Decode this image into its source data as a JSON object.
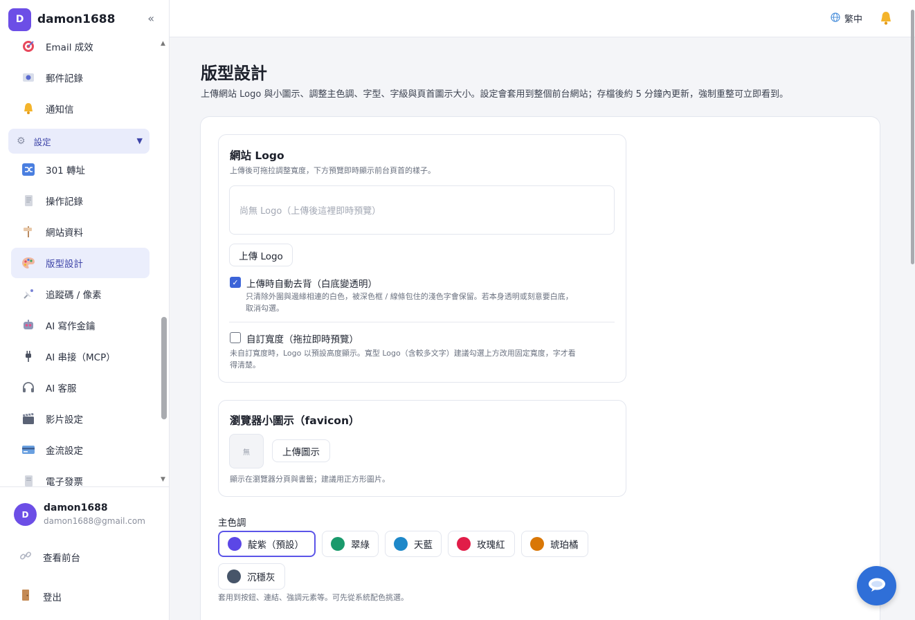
{
  "brand": {
    "initial": "D",
    "name": "damon1688",
    "collapse_glyph": "«"
  },
  "sidebar": {
    "items": [
      {
        "label": "Email 成效",
        "icon": "target-icon"
      },
      {
        "label": "郵件記錄",
        "icon": "mail-log-icon"
      },
      {
        "label": "通知信",
        "icon": "bell-icon"
      },
      {
        "label": "設定",
        "icon": "gear-icon",
        "group": true,
        "expanded": true
      },
      {
        "label": "301 轉址",
        "icon": "shuffle-icon"
      },
      {
        "label": "操作記錄",
        "icon": "scroll-icon"
      },
      {
        "label": "網站資料",
        "icon": "signpost-icon"
      },
      {
        "label": "版型設計",
        "icon": "palette-icon",
        "active": true
      },
      {
        "label": "追蹤碼 / 像素",
        "icon": "satellite-icon"
      },
      {
        "label": "AI 寫作金鑰",
        "icon": "robot-icon"
      },
      {
        "label": "AI 串接（MCP）",
        "icon": "plug-icon"
      },
      {
        "label": "AI 客服",
        "icon": "headset-icon"
      },
      {
        "label": "影片設定",
        "icon": "clapper-icon"
      },
      {
        "label": "金流設定",
        "icon": "credit-card-icon"
      },
      {
        "label": "電子發票",
        "icon": "receipt-icon"
      }
    ]
  },
  "user": {
    "initial": "D",
    "name": "damon1688",
    "email": "damon1688@gmail.com"
  },
  "footer_links": {
    "view_frontend": "查看前台",
    "logout": "登出"
  },
  "topbar": {
    "language": "繁中"
  },
  "page": {
    "title": "版型設計",
    "description": "上傳網站 Logo 與小圖示、調整主色調、字型、字級與頁首圖示大小。設定會套用到整個前台網站；存檔後約 5 分鐘內更新，強制重整可立即看到。"
  },
  "logo_section": {
    "title": "網站 Logo",
    "hint": "上傳後可拖拉調整寬度，下方預覽即時顯示前台頁首的樣子。",
    "preview_placeholder": "尚無 Logo（上傳後這裡即時預覽）",
    "upload_label": "上傳 Logo",
    "auto_remove_bg": {
      "checked": true,
      "label": "上傳時自動去背（白底變透明）",
      "hint_line1": "只清除外圍與邊緣相連的白色，被深色框 / 線條包住的淺色字會保留。若本身透明或刻意要白底，",
      "hint_line2": "取消勾選。"
    },
    "custom_width": {
      "checked": false,
      "label": "自訂寬度（拖拉即時預覽）",
      "hint_line1": "未自訂寬度時，Logo 以預設高度顯示。寬型 Logo（含較多文字）建議勾選上方改用固定寬度，字才看",
      "hint_line2": "得清楚。"
    }
  },
  "favicon_section": {
    "title": "瀏覽器小圖示（favicon）",
    "empty_label": "無",
    "upload_label": "上傳圖示",
    "hint": "顯示在瀏覽器分頁與書籤；建議用正方形圖片。"
  },
  "theme_color": {
    "label": "主色調",
    "options": [
      {
        "name": "靛紫（預設）",
        "color": "#5b47e6",
        "selected": true
      },
      {
        "name": "翠綠",
        "color": "#1a9a6c"
      },
      {
        "name": "天藍",
        "color": "#1e88c9"
      },
      {
        "name": "玫瑰紅",
        "color": "#e11d48"
      },
      {
        "name": "琥珀橘",
        "color": "#d97706"
      },
      {
        "name": "沉穩灰",
        "color": "#475569"
      }
    ],
    "hint": "套用到按鈕、連結、強調元素等。可先從系統配色挑選。"
  }
}
